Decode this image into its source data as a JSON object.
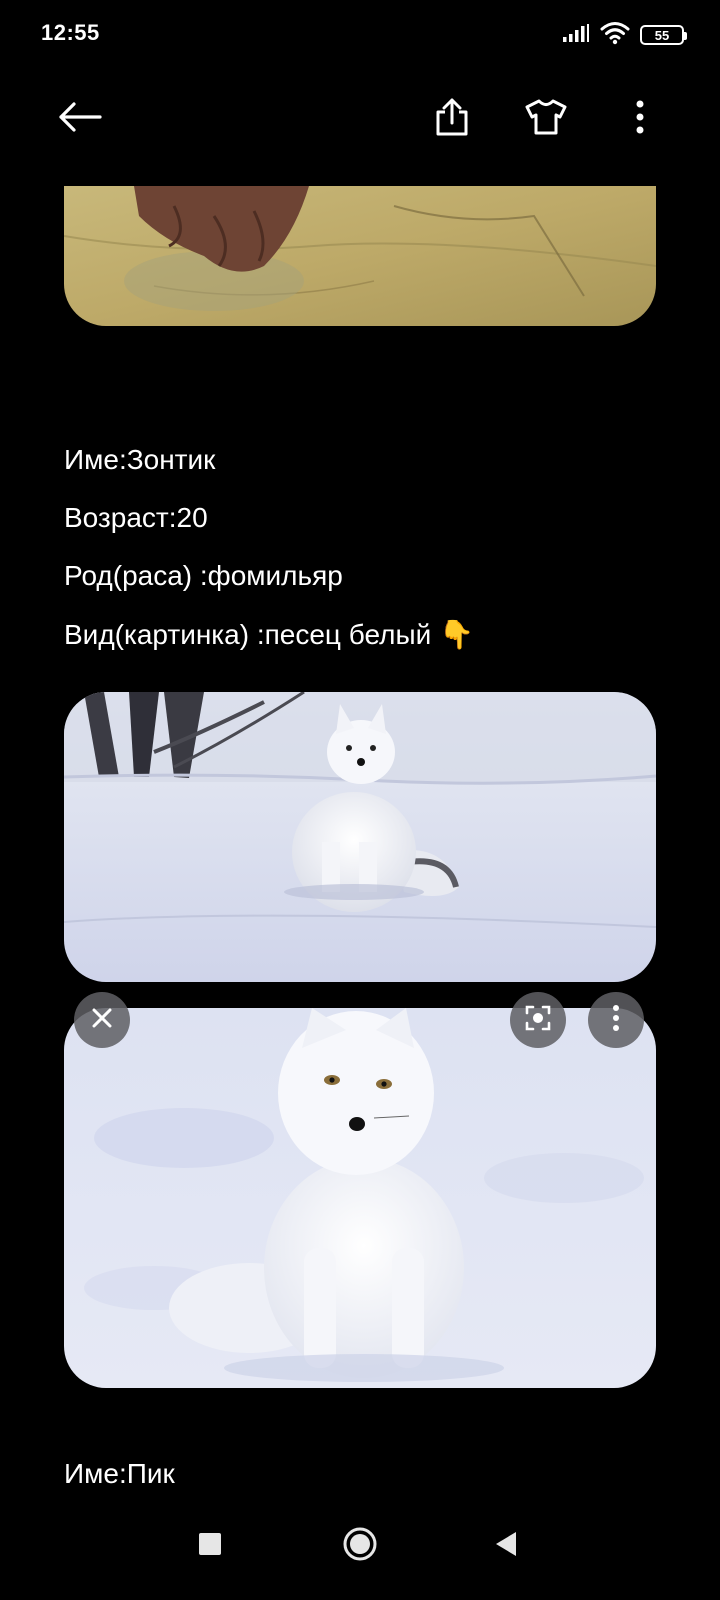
{
  "status_bar": {
    "time": "12:55",
    "battery": "55",
    "icons": [
      "signal-icon",
      "wifi-icon",
      "battery-icon"
    ]
  },
  "toolbar": {
    "icons": [
      "back-arrow-icon",
      "share-icon",
      "shirt-icon",
      "more-vert-icon"
    ]
  },
  "entry": {
    "name": "Име:Зонтик",
    "age": "Возраст:20",
    "race": "Род(раса) :фомильяр",
    "kind": "Вид(картинка) :песец белый 👇"
  },
  "next_entry": {
    "name": "Име:Пик"
  },
  "images": [
    {
      "subject": "paw on rock"
    },
    {
      "subject": "white arctic fox sitting in snow"
    },
    {
      "subject": "white arctic fox close-up in snow"
    }
  ],
  "image_overlay_icons": [
    "close-icon",
    "lens-search-icon",
    "more-vert-icon"
  ],
  "nav_bar": {
    "icons": [
      "recents-square-icon",
      "home-circle-icon",
      "back-triangle-icon"
    ]
  },
  "colors": {
    "background": "#000000",
    "text": "#ffffff"
  }
}
